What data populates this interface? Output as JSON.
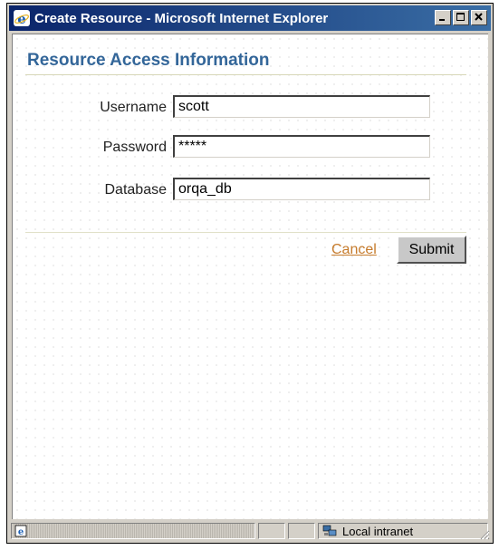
{
  "window": {
    "title": "Create Resource - Microsoft Internet Explorer",
    "title_bar_color": "#0a246a",
    "icon": "internet-explorer-icon",
    "controls": [
      "minimize-icon",
      "maximize-icon",
      "close-icon"
    ]
  },
  "form": {
    "heading": "Resource Access Information",
    "heading_color": "#336699",
    "fields": [
      {
        "label": "Username",
        "value": "scott"
      },
      {
        "label": "Password",
        "value": "*****"
      },
      {
        "label": "Database",
        "value": "orqa_db"
      }
    ],
    "cancel_label": "Cancel",
    "cancel_color": "#c67b2c",
    "submit_label": "Submit"
  },
  "statusbar": {
    "page_icon": "ie-page-icon",
    "zone_icon": "local-intranet-icon",
    "zone_text": "Local intranet"
  }
}
